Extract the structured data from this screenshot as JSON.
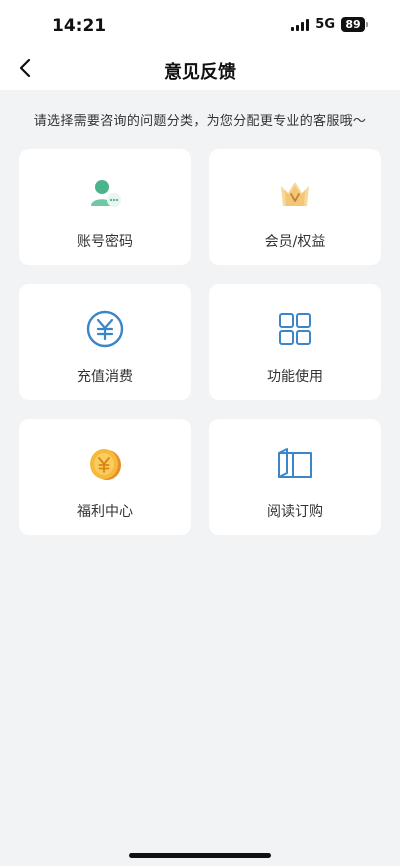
{
  "status": {
    "time": "14:21",
    "network": "5G",
    "battery": "89"
  },
  "header": {
    "title": "意见反馈"
  },
  "subtitle": "请选择需要咨询的问题分类，为您分配更专业的客服哦～",
  "categories": [
    {
      "label": "账号密码",
      "icon": "account-icon"
    },
    {
      "label": "会员/权益",
      "icon": "crown-icon"
    },
    {
      "label": "充值消费",
      "icon": "yuan-icon"
    },
    {
      "label": "功能使用",
      "icon": "grid-icon"
    },
    {
      "label": "福利中心",
      "icon": "coin-icon"
    },
    {
      "label": "阅读订购",
      "icon": "book-icon"
    }
  ],
  "colors": {
    "background": "#f2f3f5",
    "accent_blue": "#3a86c8",
    "green": "#4cb38a",
    "gold": "#f2b33a"
  }
}
